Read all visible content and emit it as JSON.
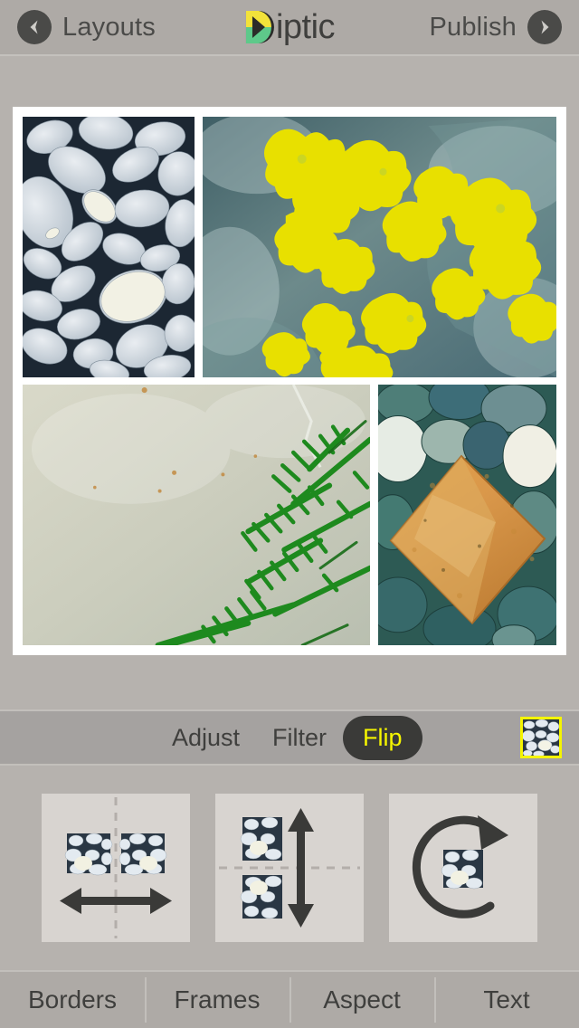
{
  "app": {
    "name": "Diptic",
    "logo_icon": "diptic-logo-icon"
  },
  "header": {
    "back_label": "Layouts",
    "back_icon": "chevron-left-circle-icon",
    "forward_label": "Publish",
    "forward_icon": "chevron-right-circle-icon",
    "title": "iptic"
  },
  "colors": {
    "bar_gray": "#aeaaa6",
    "page_gray": "#b6b2ae",
    "tabbar_gray": "#a5a2a0",
    "text_dark": "#3f3f3d",
    "accent_yellow": "#f5f500",
    "active_pill": "#3a3a38",
    "panel_tile": "#d8d4d0",
    "logo_yellow": "#f2e23a",
    "logo_green": "#5ec98a",
    "logo_dark": "#2b2b29"
  },
  "collage": {
    "frame_color": "#ffffff",
    "cells": [
      {
        "name": "photo-pebbles-grey",
        "position": "top-left",
        "description": "grey beach pebbles"
      },
      {
        "name": "photo-yellow-lichen",
        "position": "top-right",
        "description": "yellow lichen on blue-grey rock"
      },
      {
        "name": "photo-stone-fern",
        "position": "bottom-left",
        "description": "pale sandstone with green fern"
      },
      {
        "name": "photo-orange-rock",
        "position": "bottom-right",
        "description": "orange diamond rock on teal pebbles"
      }
    ]
  },
  "toolbar": {
    "tabs": [
      {
        "label": "Adjust",
        "active": false,
        "name": "tab-adjust"
      },
      {
        "label": "Filter",
        "active": false,
        "name": "tab-filter"
      },
      {
        "label": "Flip",
        "active": true,
        "name": "tab-flip"
      }
    ],
    "selected_cell_thumb": "selected-cell-thumbnail"
  },
  "flip_panel": {
    "buttons": [
      {
        "name": "flip-horizontal-button",
        "icon": "arrow-left-right-icon",
        "axis": "vertical-dashed"
      },
      {
        "name": "flip-vertical-button",
        "icon": "arrow-up-down-icon",
        "axis": "horizontal-dashed"
      },
      {
        "name": "rotate-button",
        "icon": "rotate-clockwise-icon",
        "axis": "none"
      }
    ]
  },
  "bottom_nav": {
    "items": [
      {
        "label": "Borders",
        "name": "bottom-nav-borders"
      },
      {
        "label": "Frames",
        "name": "bottom-nav-frames"
      },
      {
        "label": "Aspect",
        "name": "bottom-nav-aspect"
      },
      {
        "label": "Text",
        "name": "bottom-nav-text"
      }
    ]
  }
}
